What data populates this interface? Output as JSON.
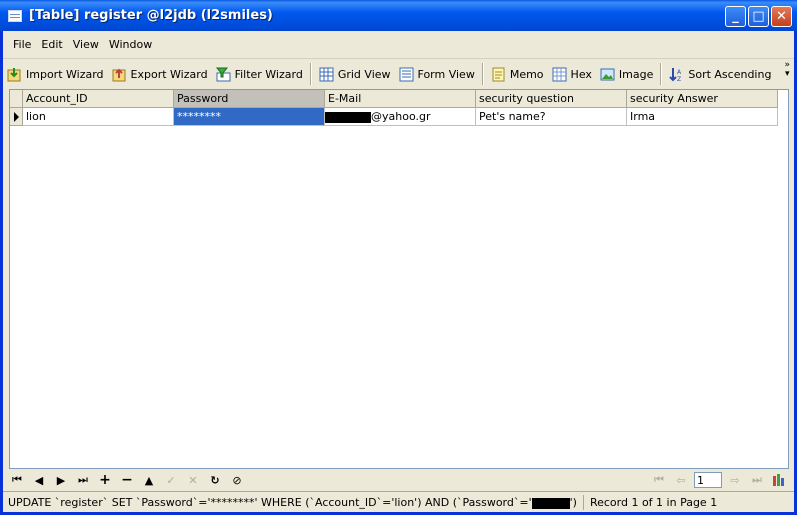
{
  "window": {
    "title": "[Table] register @l2jdb (l2smiles)",
    "controls": {
      "minimize": "_",
      "maximize": "□",
      "close": "✕"
    }
  },
  "menu": [
    "File",
    "Edit",
    "View",
    "Window"
  ],
  "toolbar": {
    "import_wizard": "Import Wizard",
    "export_wizard": "Export Wizard",
    "filter_wizard": "Filter Wizard",
    "grid_view": "Grid View",
    "form_view": "Form View",
    "memo": "Memo",
    "hex": "Hex",
    "image": "Image",
    "sort_ascending": "Sort Ascending"
  },
  "grid": {
    "columns": [
      "Account_ID",
      "Password",
      "E-Mail",
      "security question",
      "security Answer"
    ],
    "selected_column": "Password",
    "rows": [
      {
        "account_id": "lion",
        "password": "********",
        "email_domain": "@yahoo.gr",
        "question": "Pet's name?",
        "answer": "Irma"
      }
    ]
  },
  "navigator": {
    "left_buttons": [
      {
        "name": "first-record",
        "glyph": "⏮"
      },
      {
        "name": "prior-record",
        "glyph": "◀"
      },
      {
        "name": "next-record",
        "glyph": "▶"
      },
      {
        "name": "last-record",
        "glyph": "⏭"
      },
      {
        "name": "insert-record",
        "glyph": "+"
      },
      {
        "name": "delete-record",
        "glyph": "−"
      },
      {
        "name": "edit-record",
        "glyph": "▲"
      },
      {
        "name": "post-edit",
        "glyph": "✓"
      },
      {
        "name": "cancel-edit",
        "glyph": "✕"
      },
      {
        "name": "refresh",
        "glyph": "↻"
      },
      {
        "name": "stop",
        "glyph": "⊘"
      }
    ],
    "page": "1"
  },
  "status": {
    "sql": "UPDATE `register` SET `Password`='********' WHERE (`Account_ID`='lion') AND (`Password`='",
    "sql_tail": "')",
    "record_info": "Record 1 of 1 in Page 1"
  },
  "colors": {
    "accent": "#0054e3",
    "selection": "#316ac5",
    "chrome": "#ece9d8"
  }
}
